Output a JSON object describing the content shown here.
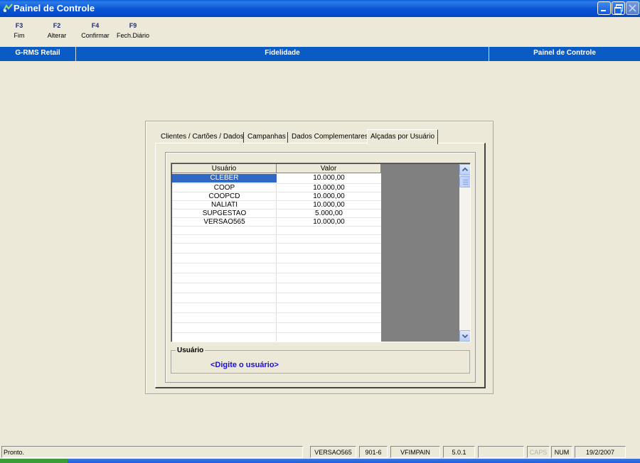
{
  "window": {
    "title": "Painel de Controle"
  },
  "function_keys": [
    {
      "key": "F3",
      "label": "Fim"
    },
    {
      "key": "F2",
      "label": "Alterar"
    },
    {
      "key": "F4",
      "label": "Confirmar"
    },
    {
      "key": "F9",
      "label": "Fech.Diário"
    }
  ],
  "header": {
    "left": "G-RMS Retail",
    "center": "Fidelidade",
    "right": "Painel de Controle"
  },
  "tabs": [
    {
      "label": "Clientes / Cartões / Dados"
    },
    {
      "label": "Campanhas"
    },
    {
      "label": "Dados Complementares"
    },
    {
      "label": "Alçadas por Usuário"
    }
  ],
  "table": {
    "columns": [
      "Usuário",
      "Valor"
    ],
    "rows": [
      [
        "CLEBER",
        "10.000,00"
      ],
      [
        "COOP",
        "10.000,00"
      ],
      [
        "COOPCD",
        "10.000,00"
      ],
      [
        "NALIATI",
        "10.000,00"
      ],
      [
        "SUPGESTAO",
        "5.000,00"
      ],
      [
        "VERSAO565",
        "10.000,00"
      ]
    ]
  },
  "user_group": {
    "legend": "Usuário",
    "value": "<Digite o usuário>"
  },
  "statusbar": {
    "message": "Pronto.",
    "user": "VERSAO565",
    "store": "901-6",
    "program": "VFIMPAIN",
    "version": "5.0.1",
    "caps": "CAPS",
    "num": "NUM",
    "date": "19/2/2007"
  },
  "colors": {
    "titlebar": "#0A5FD8",
    "header_band": "#0A5BC4",
    "selection": "#3168C6",
    "user_prompt": "#1A0FD6"
  }
}
